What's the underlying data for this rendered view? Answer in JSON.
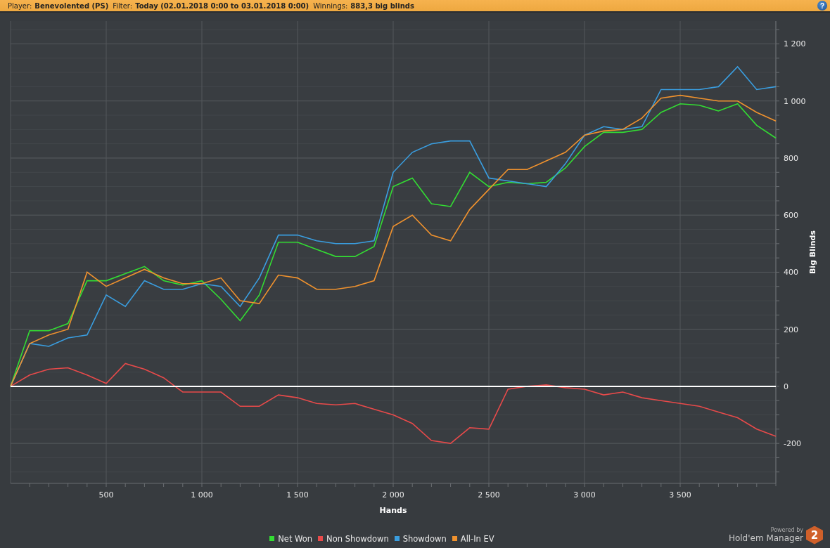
{
  "header": {
    "fields": [
      {
        "label": "Player:",
        "value": "Benevolented (PS)"
      },
      {
        "label": "Filter:",
        "value": "Today (02.01.2018 0:00 to 03.01.2018 0:00)"
      },
      {
        "label": "Winnings:",
        "value": "883,3 big blinds"
      }
    ],
    "help": "?"
  },
  "chart": {
    "chart_data": {
      "type": "line",
      "grid": true,
      "xlabel": "Hands",
      "ylabel": "Big Blinds",
      "xlim": [
        0,
        4000
      ],
      "ylim": [
        -340,
        1280
      ],
      "xticks": [
        {
          "value": 500,
          "label": "500"
        },
        {
          "value": 1000,
          "label": "1 000"
        },
        {
          "value": 1500,
          "label": "1 500"
        },
        {
          "value": 2000,
          "label": "2 000"
        },
        {
          "value": 2500,
          "label": "2 500"
        },
        {
          "value": 3000,
          "label": "3 000"
        },
        {
          "value": 3500,
          "label": "3 500"
        }
      ],
      "yticks": [
        {
          "value": -200,
          "label": "-200"
        },
        {
          "value": 0,
          "label": "0"
        },
        {
          "value": 200,
          "label": "200"
        },
        {
          "value": 400,
          "label": "400"
        },
        {
          "value": 600,
          "label": "600"
        },
        {
          "value": 800,
          "label": "800"
        },
        {
          "value": 1000,
          "label": "1 000"
        },
        {
          "value": 1200,
          "label": "1 200"
        }
      ],
      "x": [
        0,
        100,
        200,
        300,
        400,
        500,
        600,
        700,
        800,
        900,
        1000,
        1100,
        1200,
        1300,
        1400,
        1500,
        1600,
        1700,
        1800,
        1900,
        2000,
        2100,
        2200,
        2300,
        2400,
        2500,
        2600,
        2700,
        2800,
        2900,
        3000,
        3100,
        3200,
        3300,
        3400,
        3500,
        3600,
        3700,
        3800,
        3900,
        4000
      ],
      "series": [
        {
          "name": "Net Won",
          "color": "#33dd33",
          "values": [
            0,
            195,
            195,
            220,
            370,
            370,
            395,
            420,
            370,
            355,
            370,
            305,
            230,
            320,
            505,
            505,
            480,
            455,
            455,
            490,
            700,
            730,
            640,
            630,
            750,
            700,
            715,
            710,
            715,
            765,
            840,
            890,
            890,
            900,
            960,
            990,
            985,
            965,
            990,
            915,
            870
          ]
        },
        {
          "name": "Non Showdown",
          "color": "#e84a4a",
          "values": [
            0,
            40,
            60,
            65,
            40,
            10,
            80,
            60,
            30,
            -20,
            -20,
            -20,
            -70,
            -70,
            -30,
            -40,
            -60,
            -65,
            -60,
            -80,
            -100,
            -130,
            -190,
            -200,
            -145,
            -150,
            -10,
            0,
            5,
            -5,
            -10,
            -30,
            -20,
            -40,
            -50,
            -60,
            -70,
            -90,
            -110,
            -150,
            -175
          ]
        },
        {
          "name": "Showdown",
          "color": "#3a9ee0",
          "values": [
            0,
            150,
            140,
            170,
            180,
            320,
            280,
            370,
            340,
            340,
            360,
            350,
            280,
            380,
            530,
            530,
            510,
            500,
            500,
            510,
            750,
            820,
            850,
            860,
            860,
            730,
            720,
            710,
            700,
            780,
            880,
            910,
            900,
            910,
            1040,
            1040,
            1040,
            1050,
            1120,
            1040,
            1050
          ]
        },
        {
          "name": "All-In EV",
          "color": "#f0922e",
          "values": [
            0,
            150,
            180,
            200,
            400,
            350,
            380,
            410,
            380,
            360,
            360,
            380,
            300,
            290,
            390,
            380,
            340,
            340,
            350,
            370,
            560,
            600,
            530,
            510,
            620,
            690,
            760,
            760,
            790,
            820,
            880,
            895,
            900,
            940,
            1010,
            1020,
            1010,
            1000,
            1000,
            960,
            930
          ]
        }
      ]
    }
  },
  "branding": {
    "powered_by": "Powered by",
    "product": "Hold'em Manager",
    "badge": "2"
  }
}
